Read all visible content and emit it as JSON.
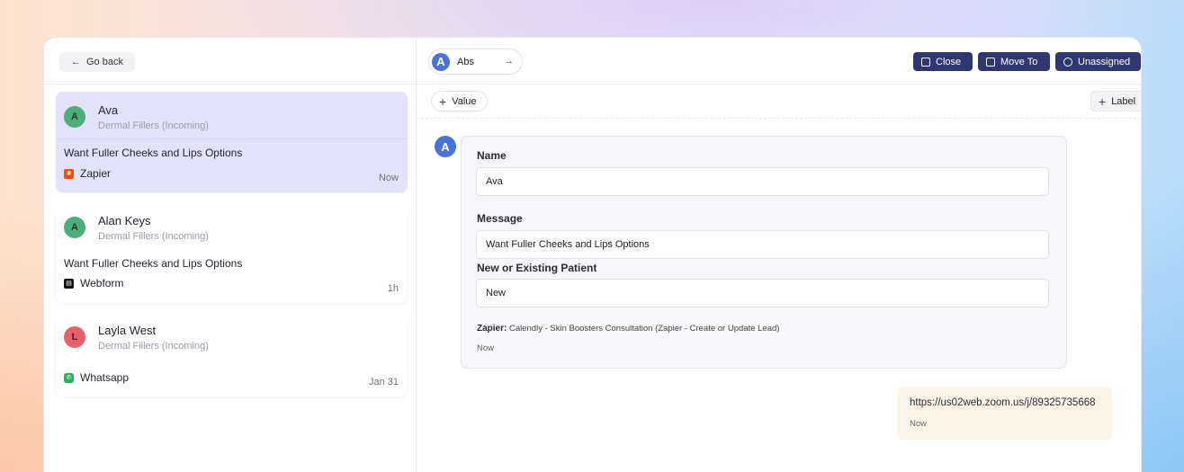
{
  "nav": {
    "go_back": "Go back",
    "back_arrow": "←"
  },
  "conversations": [
    {
      "initial": "A",
      "name": "Ava",
      "subtitle": "Dermal Fillers (Incoming)",
      "message": "Want Fuller Cheeks and Lips Options",
      "source": "Zapier",
      "source_icon": "zapier-icon",
      "time": "Now",
      "avatar_color": "#4caf7a",
      "active": true
    },
    {
      "initial": "A",
      "name": "Alan Keys",
      "subtitle": "Dermal Fillers (Incoming)",
      "message": "Want Fuller Cheeks and Lips Options",
      "source": "Webform",
      "source_icon": "webform-icon",
      "time": "1h",
      "avatar_color": "#4caf7a",
      "active": false
    },
    {
      "initial": "L",
      "name": "Layla West",
      "subtitle": "Dermal Fillers (Incoming)",
      "message": "",
      "source": "Whatsapp",
      "source_icon": "whatsapp-icon",
      "time": "Jan 31",
      "avatar_color": "#e5606a",
      "active": false
    }
  ],
  "header": {
    "assignee_initial": "A",
    "assignee_name": "Abs",
    "assignee_arrow": "→",
    "close_label": "Close",
    "move_label": "Move To",
    "unassigned_label": "Unassigned",
    "button_color": "#2e3770"
  },
  "toolbar": {
    "value_label": "Value",
    "label_label": "Label",
    "plus": "+"
  },
  "message": {
    "avatar_initial": "A",
    "fields": [
      {
        "label": "Name",
        "value": "Ava"
      },
      {
        "label": "Message",
        "value": "Want Fuller Cheeks and Lips Options"
      },
      {
        "label": "New or Existing Patient",
        "value": "New"
      }
    ],
    "source_prefix": "Zapier:",
    "source_text": " Calendly - Skin Boosters Consultation (Zapier - Create or Update Lead)",
    "time": "Now"
  },
  "outgoing": {
    "text": "https://us02web.zoom.us/j/89325735668",
    "time": "Now"
  }
}
